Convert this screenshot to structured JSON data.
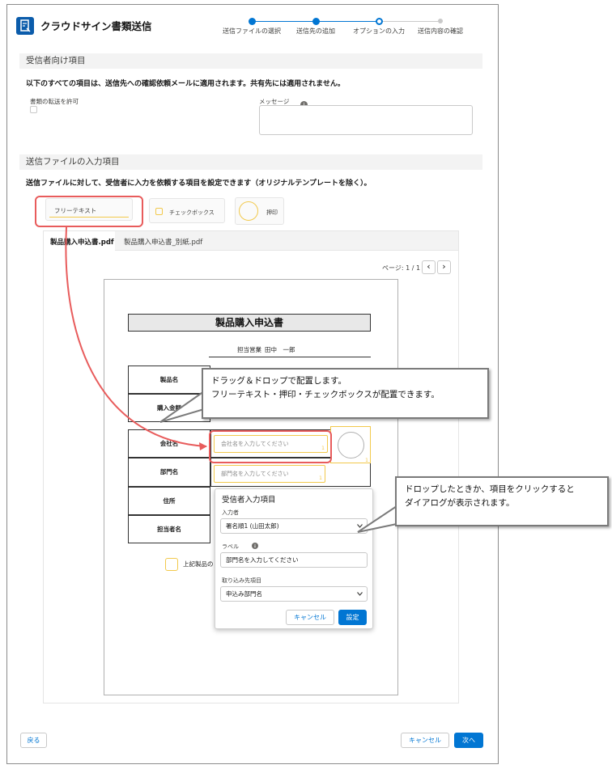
{
  "header": {
    "title": "クラウドサイン書類送信",
    "steps": [
      {
        "label": "送信ファイルの選択",
        "state": "done"
      },
      {
        "label": "送信先の追加",
        "state": "done"
      },
      {
        "label": "オプションの入力",
        "state": "current"
      },
      {
        "label": "送信内容の確認",
        "state": "todo"
      }
    ]
  },
  "recipient_section": {
    "title": "受信者向け項目",
    "description": "以下のすべての項目は、送信先への確認依頼メールに適用されます。共有先には適用されません。",
    "allow_forward_label": "書類の転送を許可",
    "message_label": "メッセージ"
  },
  "input_section": {
    "title": "送信ファイルの入力項目",
    "description": "送信ファイルに対して、受信者に入力を依頼する項目を設定できます（オリジナルテンプレートを除く）。",
    "tools": [
      "フリーテキスト",
      "チェックボックス",
      "押印"
    ]
  },
  "tabs": [
    {
      "label": "製品購入申込書.pdf",
      "active": true
    },
    {
      "label": "製品購入申込書_別紙.pdf",
      "active": false
    }
  ],
  "pager": {
    "label": "ページ: 1 / 1",
    "prev": "‹",
    "next": "›"
  },
  "document": {
    "title": "製品購入申込書",
    "sales_rep_label": "担当営業",
    "sales_rep_name": "田中　一郎",
    "rows": [
      "製品名",
      "購入金額",
      "会社名",
      "部門名",
      "住所",
      "担当者名"
    ],
    "checkbox_text": "上記製品の",
    "fields": {
      "company_placeholder": "会社名を入力してください",
      "department_placeholder": "部門名を入力してください",
      "badge": "1"
    }
  },
  "dialog": {
    "title": "受信者入力項目",
    "input_by_label": "入力者",
    "input_by_value": "署名順1 (山田太郎)",
    "label_label": "ラベル",
    "label_placeholder": "部門名を入力してください",
    "import_label": "取り込み先項目",
    "import_value": "申込み部門名",
    "cancel": "キャンセル",
    "set": "設定"
  },
  "callouts": {
    "drag": [
      "ドラッグ＆ドロップで配置します。",
      "フリーテキスト・押印・チェックボックスが配置できます。"
    ],
    "click": [
      "ドロップしたときか、項目をクリックすると",
      "ダイアログが表示されます。"
    ]
  },
  "footer": {
    "back": "戻る",
    "cancel": "キャンセル",
    "next": "次へ"
  },
  "colors": {
    "brand": "#0176d3",
    "highlight": "#e85c5c",
    "field": "#f2c94c"
  }
}
